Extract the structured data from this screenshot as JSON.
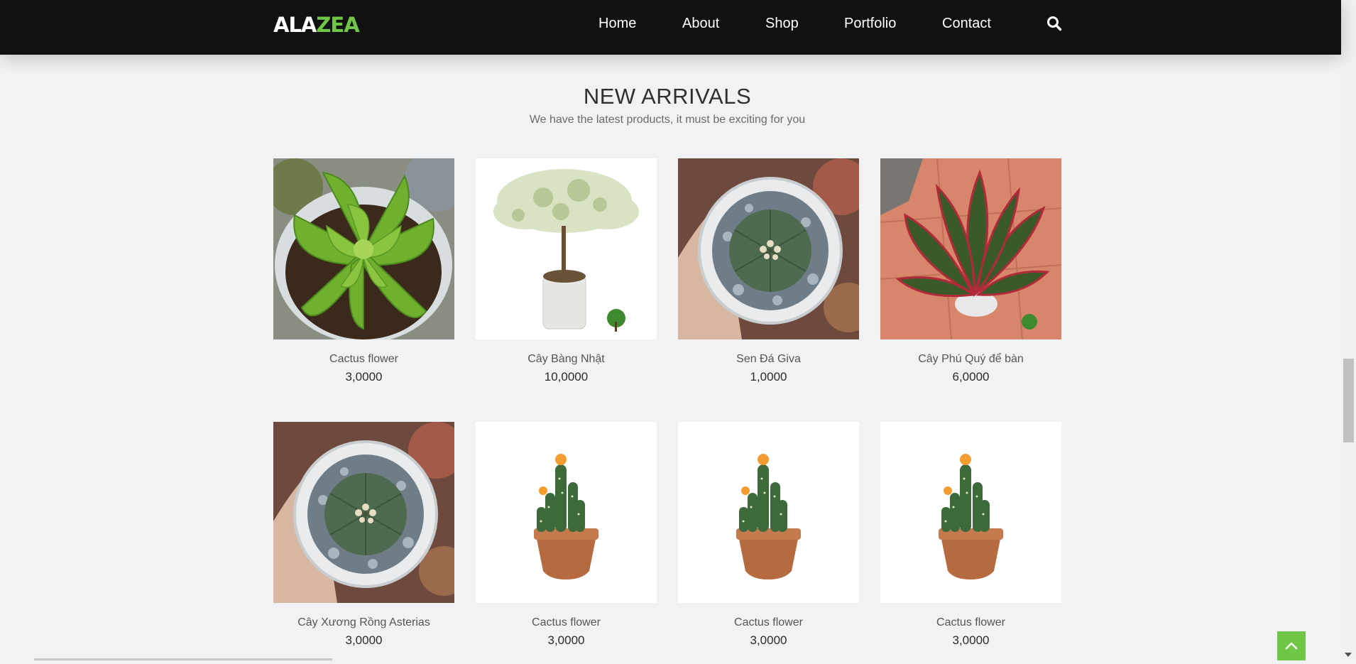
{
  "brand": {
    "logo_part1": "ALA",
    "logo_part2": "ZEA",
    "accent_color": "#70c745"
  },
  "nav": {
    "items": [
      {
        "label": "Home"
      },
      {
        "label": "About"
      },
      {
        "label": "Shop"
      },
      {
        "label": "Portfolio"
      },
      {
        "label": "Contact"
      }
    ],
    "search_icon": "search-icon"
  },
  "section": {
    "title": "NEW ARRIVALS",
    "subtitle": "We have the latest products, it must be exciting for you"
  },
  "products": [
    {
      "name": "Cactus flower",
      "price": "3,0000",
      "image": "echeveria-succulent"
    },
    {
      "name": "Cây Bàng Nhật",
      "price": "10,0000",
      "image": "bang-tree-white-pot"
    },
    {
      "name": "Sen Đá Giva",
      "price": "1,0000",
      "image": "astrophytum-in-hand"
    },
    {
      "name": "Cây Phú Quý để bàn",
      "price": "6,0000",
      "image": "aglaonema-red"
    },
    {
      "name": "Cây Xương Rồng Asterias",
      "price": "3,0000",
      "image": "astrophytum-in-hand"
    },
    {
      "name": "Cactus flower",
      "price": "3,0000",
      "image": "cactus-terracotta"
    },
    {
      "name": "Cactus flower",
      "price": "3,0000",
      "image": "cactus-terracotta"
    },
    {
      "name": "Cactus flower",
      "price": "3,0000",
      "image": "cactus-terracotta"
    }
  ],
  "back_to_top_icon": "chevron-up-icon"
}
